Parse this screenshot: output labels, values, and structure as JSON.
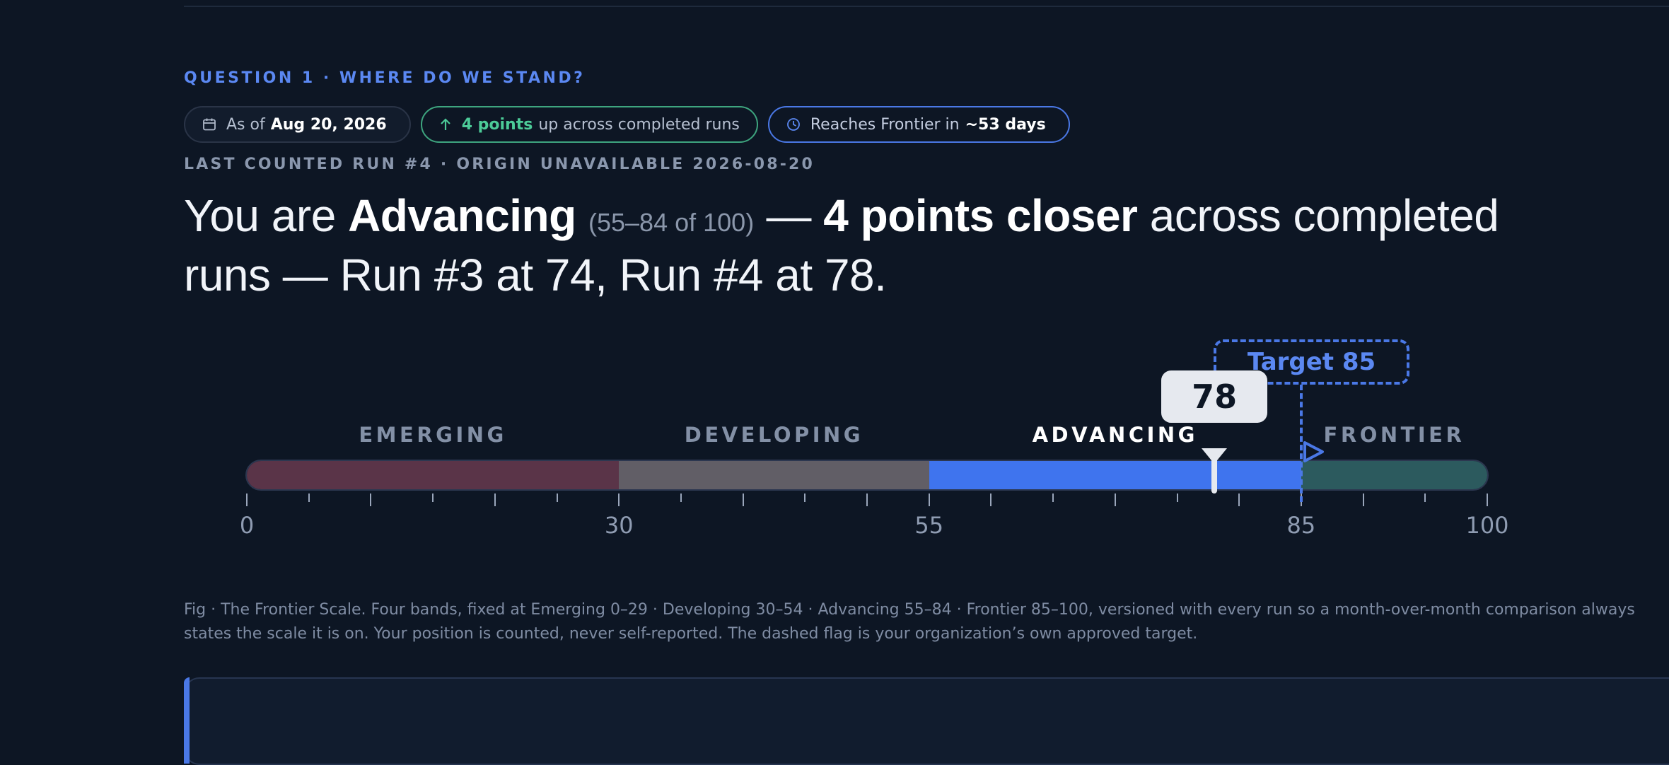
{
  "section": {
    "eyebrow": "QUESTION 1 · WHERE DO WE STAND?",
    "meta": "LAST COUNTED RUN #4 · ORIGIN UNAVAILABLE 2026-08-20"
  },
  "chips": {
    "date": {
      "icon": "calendar-icon",
      "prefix": "As of",
      "value": "Aug 20, 2026"
    },
    "progress": {
      "icon": "arrow-up-icon",
      "value": "4 points",
      "suffix": "up across completed runs"
    },
    "eta": {
      "icon": "clock-icon",
      "prefix": "Reaches Frontier in",
      "value": "~53 days"
    }
  },
  "headline": {
    "lead": "You are",
    "band": "Advancing",
    "range": "(55–84 of 100)",
    "dash1": "—",
    "delta": "4 points closer",
    "tail": "across completed runs — Run #3 at 74, Run #4 at 78."
  },
  "scale": {
    "min": 0,
    "max": 100,
    "bands": [
      {
        "name": "EMERGING",
        "from": 0,
        "to": 30,
        "color": "#5a3448",
        "active": false
      },
      {
        "name": "DEVELOPING",
        "from": 30,
        "to": 55,
        "color": "#615e66",
        "active": false
      },
      {
        "name": "ADVANCING",
        "from": 55,
        "to": 85,
        "color": "#3f74ee",
        "active": true
      },
      {
        "name": "FRONTIER",
        "from": 85,
        "to": 100,
        "color": "#2c5a5e",
        "active": false
      }
    ],
    "tick_labels": [
      "0",
      "30",
      "55",
      "85",
      "100"
    ],
    "current_value": 78,
    "current_label": "78",
    "target_value": 85,
    "target_label": "Target 85"
  },
  "caption": "Fig · The Frontier Scale. Four bands, fixed at Emerging 0–29 · Developing 30–54 · Advancing 55–84 · Frontier 85–100, versioned with every run so a month-over-month comparison always states the scale it is on. Your position is counted, never self-reported. The dashed flag is your organization’s own approved target.",
  "colors": {
    "background": "#0d1624",
    "accent": "#4a78e6",
    "positive": "#4ccb98"
  }
}
